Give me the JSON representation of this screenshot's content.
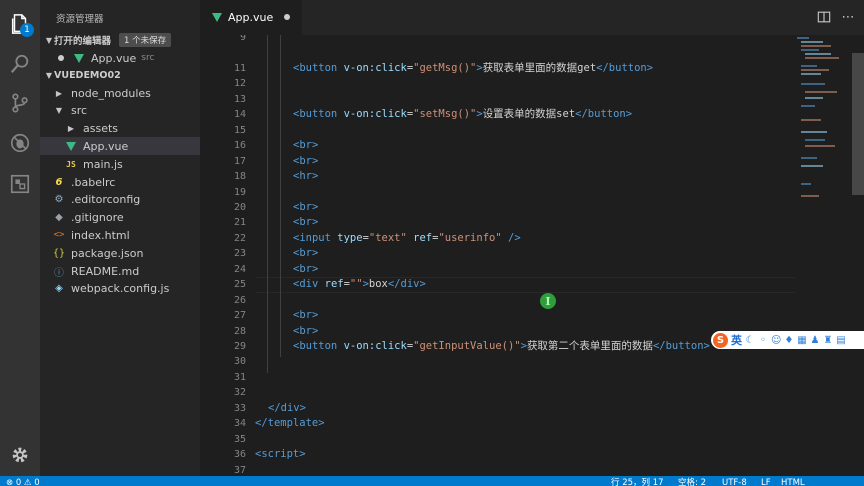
{
  "activity": {
    "items": [
      "files-icon",
      "search-icon",
      "source-control-icon",
      "debug-icon",
      "extensions-icon"
    ],
    "explorer_badge": "1",
    "settings": "gear-icon"
  },
  "sidebar": {
    "title": "资源管理器",
    "open_editors": {
      "label": "打开的编辑器",
      "unsaved": "1 个未保存",
      "file": "App.vue",
      "folder": "src"
    },
    "project": "VUEDEMO02",
    "tree": [
      {
        "name": "node_modules",
        "kind": "folder-closed",
        "indent": 1
      },
      {
        "name": "src",
        "kind": "folder-open",
        "indent": 1
      },
      {
        "name": "assets",
        "kind": "folder-closed",
        "indent": 2
      },
      {
        "name": "App.vue",
        "kind": "vue",
        "indent": 2,
        "selected": true
      },
      {
        "name": "main.js",
        "kind": "js",
        "indent": 2
      },
      {
        "name": ".babelrc",
        "kind": "babel",
        "indent": 1
      },
      {
        "name": ".editorconfig",
        "kind": "gear",
        "indent": 1
      },
      {
        "name": ".gitignore",
        "kind": "git",
        "indent": 1
      },
      {
        "name": "index.html",
        "kind": "html",
        "indent": 1
      },
      {
        "name": "package.json",
        "kind": "json",
        "indent": 1
      },
      {
        "name": "README.md",
        "kind": "info",
        "indent": 1
      },
      {
        "name": "webpack.config.js",
        "kind": "webpack",
        "indent": 1
      }
    ]
  },
  "tabs": [
    {
      "label": "App.vue",
      "modified": true
    }
  ],
  "editor": {
    "first_line": 9,
    "lines": [
      {
        "n": "9",
        "tokens": []
      },
      {
        "n": "11",
        "tokens": [
          [
            "t",
            "<button"
          ],
          [
            "x",
            " "
          ],
          [
            "a",
            "v-on:click"
          ],
          [
            "x",
            "="
          ],
          [
            "s",
            "\"getMsg()\""
          ],
          [
            "t",
            ">"
          ],
          [
            "x",
            "获取表单里面的数据get"
          ],
          [
            "t",
            "</button>"
          ]
        ]
      },
      {
        "n": "12",
        "tokens": []
      },
      {
        "n": "13",
        "tokens": []
      },
      {
        "n": "14",
        "tokens": [
          [
            "t",
            "<button"
          ],
          [
            "x",
            " "
          ],
          [
            "a",
            "v-on:click"
          ],
          [
            "x",
            "="
          ],
          [
            "s",
            "\"setMsg()\""
          ],
          [
            "t",
            ">"
          ],
          [
            "x",
            "设置表单的数据set"
          ],
          [
            "t",
            "</button>"
          ]
        ]
      },
      {
        "n": "15",
        "tokens": []
      },
      {
        "n": "16",
        "tokens": [
          [
            "t",
            "<br>"
          ]
        ]
      },
      {
        "n": "17",
        "tokens": [
          [
            "t",
            "<br>"
          ]
        ]
      },
      {
        "n": "18",
        "tokens": [
          [
            "t",
            "<hr>"
          ]
        ]
      },
      {
        "n": "19",
        "tokens": []
      },
      {
        "n": "20",
        "tokens": [
          [
            "t",
            "<br>"
          ]
        ]
      },
      {
        "n": "21",
        "tokens": [
          [
            "t",
            "<br>"
          ]
        ]
      },
      {
        "n": "22",
        "tokens": [
          [
            "t",
            "<input"
          ],
          [
            "x",
            " "
          ],
          [
            "a",
            "type"
          ],
          [
            "x",
            "="
          ],
          [
            "s",
            "\"text\""
          ],
          [
            "x",
            " "
          ],
          [
            "a",
            "ref"
          ],
          [
            "x",
            "="
          ],
          [
            "s",
            "\"userinfo\""
          ],
          [
            "x",
            " "
          ],
          [
            "t",
            "/>"
          ]
        ]
      },
      {
        "n": "23",
        "tokens": [
          [
            "t",
            "<br>"
          ]
        ]
      },
      {
        "n": "24",
        "tokens": [
          [
            "t",
            "<br>"
          ]
        ]
      },
      {
        "n": "25",
        "tokens": [
          [
            "t",
            "<div"
          ],
          [
            "x",
            " "
          ],
          [
            "a",
            "ref"
          ],
          [
            "x",
            "="
          ],
          [
            "s",
            "\"\""
          ],
          [
            "t",
            ">"
          ],
          [
            "x",
            "box"
          ],
          [
            "t",
            "</div>"
          ]
        ]
      },
      {
        "n": "26",
        "tokens": []
      },
      {
        "n": "27",
        "tokens": [
          [
            "t",
            "<br>"
          ]
        ]
      },
      {
        "n": "28",
        "tokens": [
          [
            "t",
            "<br>"
          ]
        ]
      },
      {
        "n": "29",
        "tokens": [
          [
            "t",
            "<button"
          ],
          [
            "x",
            " "
          ],
          [
            "a",
            "v-on:click"
          ],
          [
            "x",
            "="
          ],
          [
            "s",
            "\"getInputValue()\""
          ],
          [
            "t",
            ">"
          ],
          [
            "x",
            "获取第二个表单里面的数据"
          ],
          [
            "t",
            "</button>"
          ]
        ]
      },
      {
        "n": "30",
        "tokens": []
      },
      {
        "n": "31",
        "tokens": []
      },
      {
        "n": "32",
        "tokens": []
      },
      {
        "n": "33",
        "tokens": [
          [
            "t",
            "</div>"
          ]
        ]
      },
      {
        "n": "34",
        "tokens": [
          [
            "t",
            "</template>"
          ]
        ]
      },
      {
        "n": "35",
        "tokens": []
      },
      {
        "n": "36",
        "tokens": [
          [
            "t",
            "<script>"
          ]
        ]
      },
      {
        "n": "37",
        "tokens": []
      }
    ]
  },
  "ime": {
    "lang": "英",
    "logo": "S"
  },
  "status": {
    "left": "⊗ 0  ⚠ 0",
    "position": "行 25，列 17",
    "spaces": "空格: 2",
    "encoding": "UTF-8",
    "eol": "LF",
    "language": "HTML"
  }
}
